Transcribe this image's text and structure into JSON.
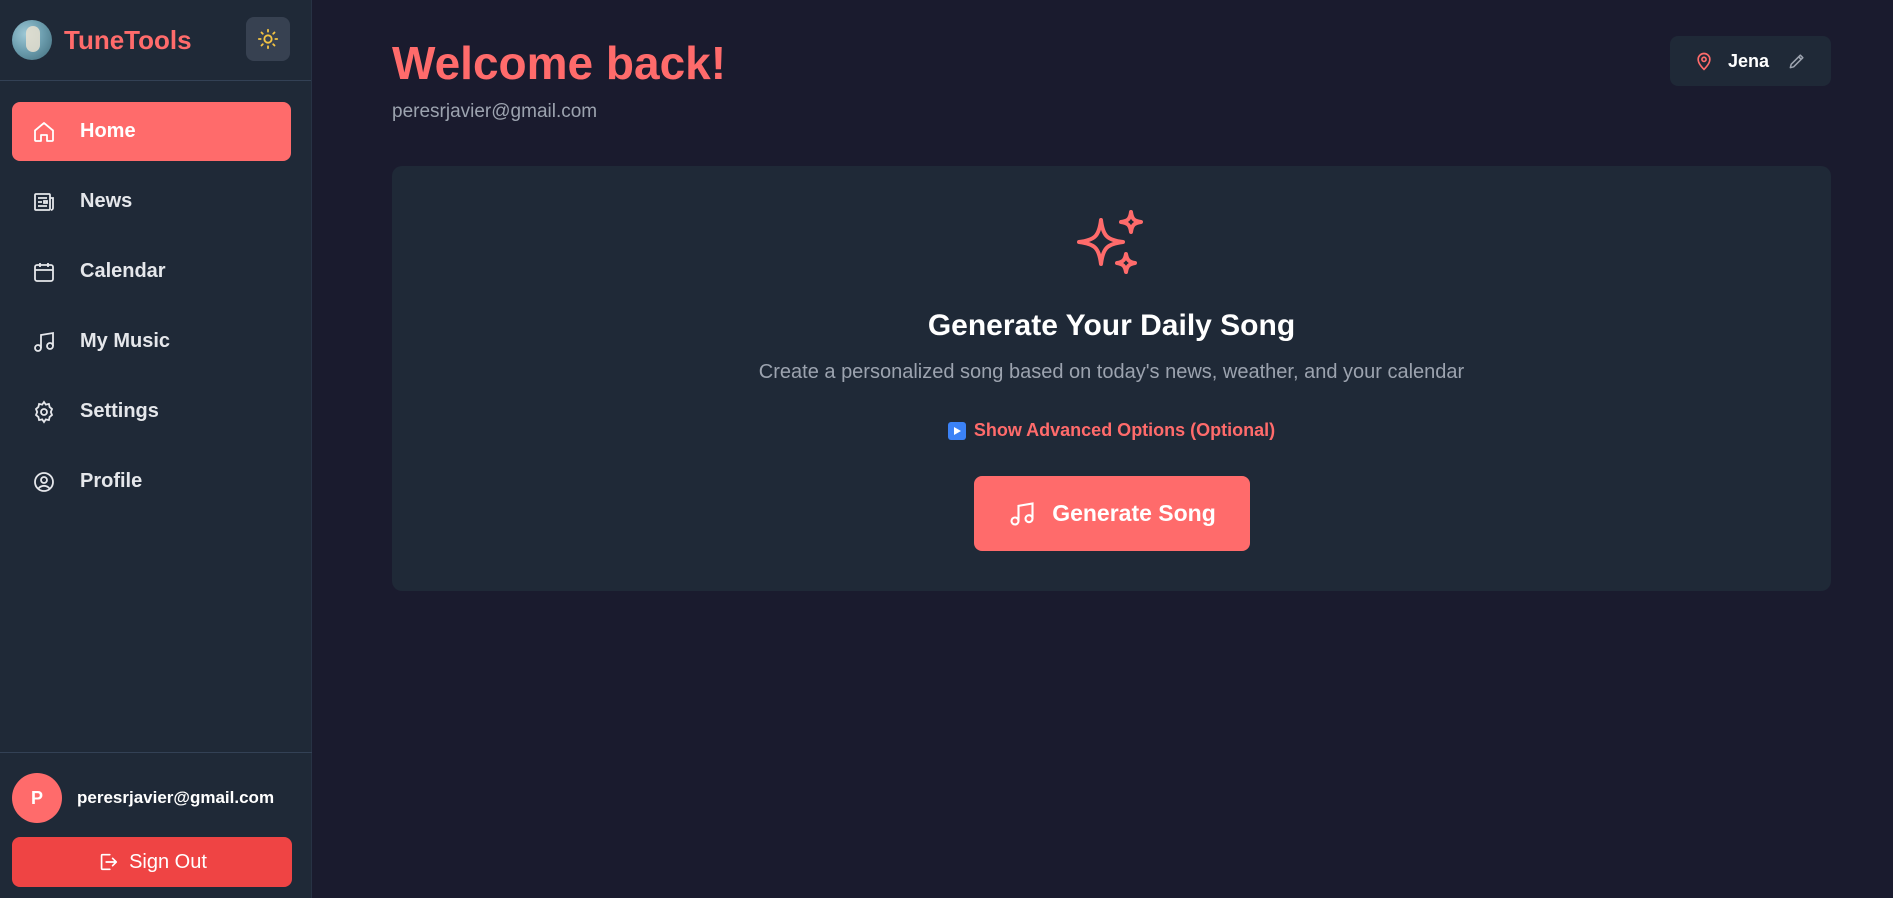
{
  "brand": {
    "name": "TuneTools",
    "logo_icon": "app-logo",
    "theme_icon": "sun-icon"
  },
  "colors": {
    "accent": "#ff6b6b",
    "danger": "#ef4444",
    "sidebar_bg": "#1f2937",
    "page_bg": "#1a1b2e",
    "sun": "#f5c542"
  },
  "nav": {
    "items": [
      {
        "label": "Home",
        "icon": "home-icon",
        "active": true
      },
      {
        "label": "News",
        "icon": "newspaper-icon",
        "active": false
      },
      {
        "label": "Calendar",
        "icon": "calendar-icon",
        "active": false
      },
      {
        "label": "My Music",
        "icon": "music-note-icon",
        "active": false
      },
      {
        "label": "Settings",
        "icon": "gear-icon",
        "active": false
      },
      {
        "label": "Profile",
        "icon": "user-circle-icon",
        "active": false
      }
    ]
  },
  "user": {
    "avatar_initial": "P",
    "email": "peresrjavier@gmail.com"
  },
  "sidebar_footer": {
    "signout_label": "Sign Out"
  },
  "header": {
    "title": "Welcome back!",
    "email": "peresrjavier@gmail.com"
  },
  "location": {
    "city": "Jena"
  },
  "card": {
    "title": "Generate Your Daily Song",
    "subtitle": "Create a personalized song based on today's news, weather, and your calendar",
    "advanced_label": "Show Advanced Options (Optional)",
    "button_label": "Generate Song"
  }
}
